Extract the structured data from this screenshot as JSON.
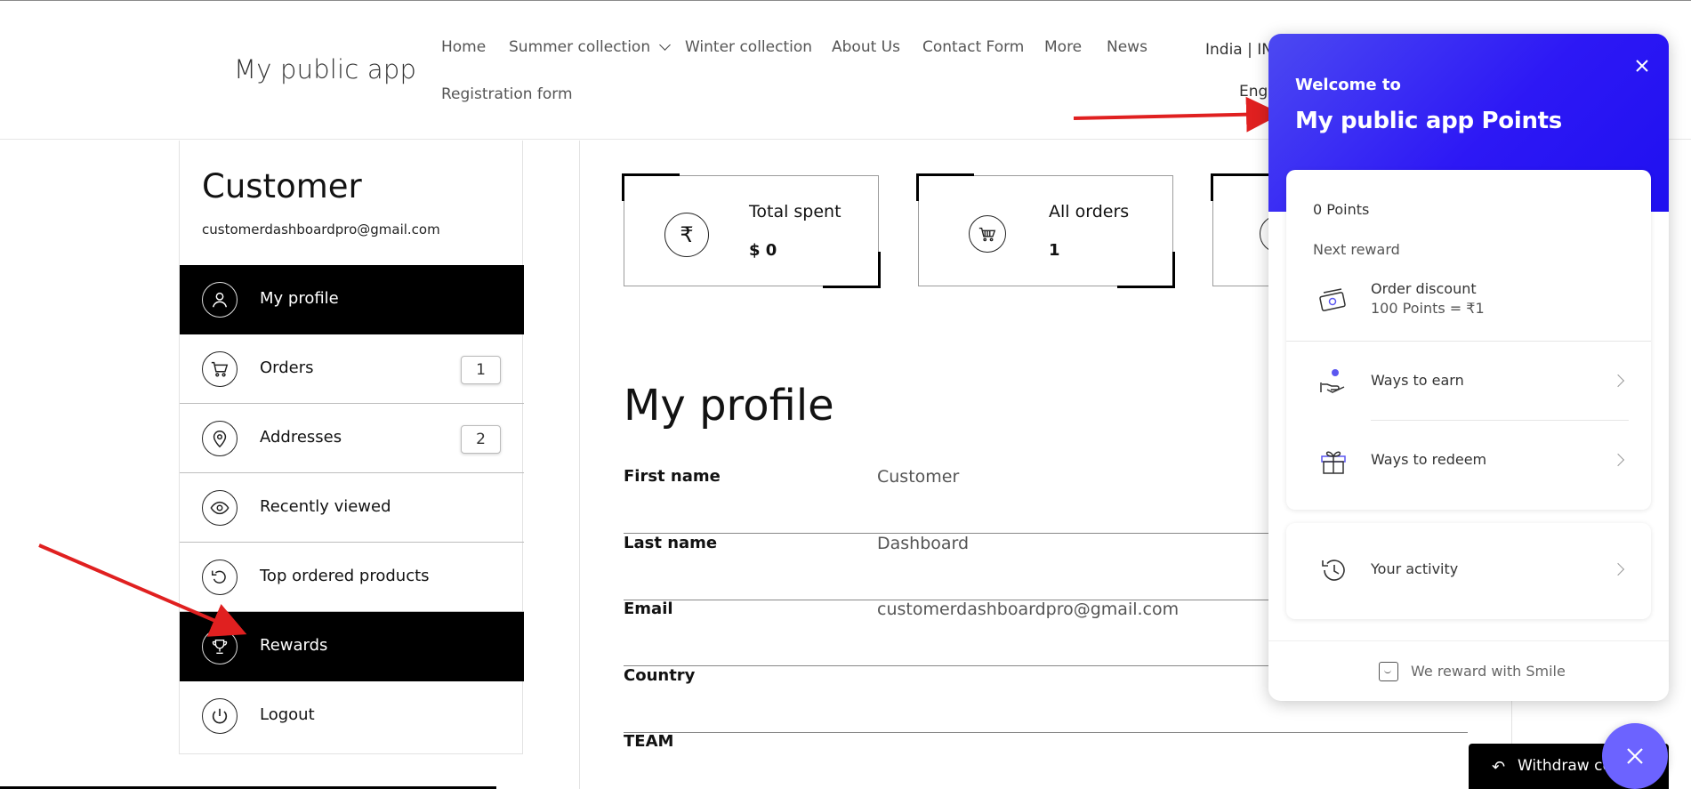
{
  "header": {
    "brand": "My public app",
    "nav": [
      {
        "label": "Home"
      },
      {
        "label": "Summer collection"
      },
      {
        "label": "Winter collection"
      },
      {
        "label": "About Us"
      },
      {
        "label": "Contact Form"
      },
      {
        "label": "More"
      },
      {
        "label": "News"
      },
      {
        "label": "Registration form"
      }
    ],
    "locale": "India | IN",
    "language": "Engl"
  },
  "sidebar": {
    "name": "Customer",
    "email": "customerdashboardpro@gmail.com",
    "items": [
      {
        "label": "My profile",
        "icon": "user-icon",
        "active": true
      },
      {
        "label": "Orders",
        "icon": "cart-icon",
        "count": "1"
      },
      {
        "label": "Addresses",
        "icon": "location-pin-icon",
        "count": "2"
      },
      {
        "label": "Recently viewed",
        "icon": "eye-icon"
      },
      {
        "label": "Top ordered products",
        "icon": "refresh-icon"
      },
      {
        "label": "Rewards",
        "icon": "trophy-icon",
        "active": true
      },
      {
        "label": "Logout",
        "icon": "power-icon"
      }
    ]
  },
  "stats": [
    {
      "label": "Total spent",
      "value": "$ 0",
      "icon": "rupee-icon",
      "icon_glyph": "₹"
    },
    {
      "label": "All orders",
      "value": "1",
      "icon": "cart-icon"
    }
  ],
  "profile": {
    "title": "My profile",
    "rows": [
      {
        "key": "First name",
        "value": "Customer"
      },
      {
        "key": "Last name",
        "value": "Dashboard"
      },
      {
        "key": "Email",
        "value": "customerdashboardpro@gmail.com"
      },
      {
        "key": "Country",
        "value": ""
      },
      {
        "key": "TEAM",
        "value": ""
      }
    ]
  },
  "rewards": {
    "welcome": "Welcome to",
    "title": "My public app Points",
    "points": "0 Points",
    "next_reward_label": "Next reward",
    "next_reward_name": "Order discount",
    "next_reward_desc": "100 Points = ₹1",
    "rows": [
      {
        "label": "Ways to earn",
        "icon": "hand-coin-icon"
      },
      {
        "label": "Ways to redeem",
        "icon": "gift-icon"
      }
    ],
    "activity_label": "Your activity",
    "footer": "We reward with Smile",
    "accent": "#2d18f5"
  },
  "withdraw": {
    "label": "Withdraw co"
  },
  "colors": {
    "annotation_arrow": "#e02020",
    "launcher": "#6c63ff"
  }
}
